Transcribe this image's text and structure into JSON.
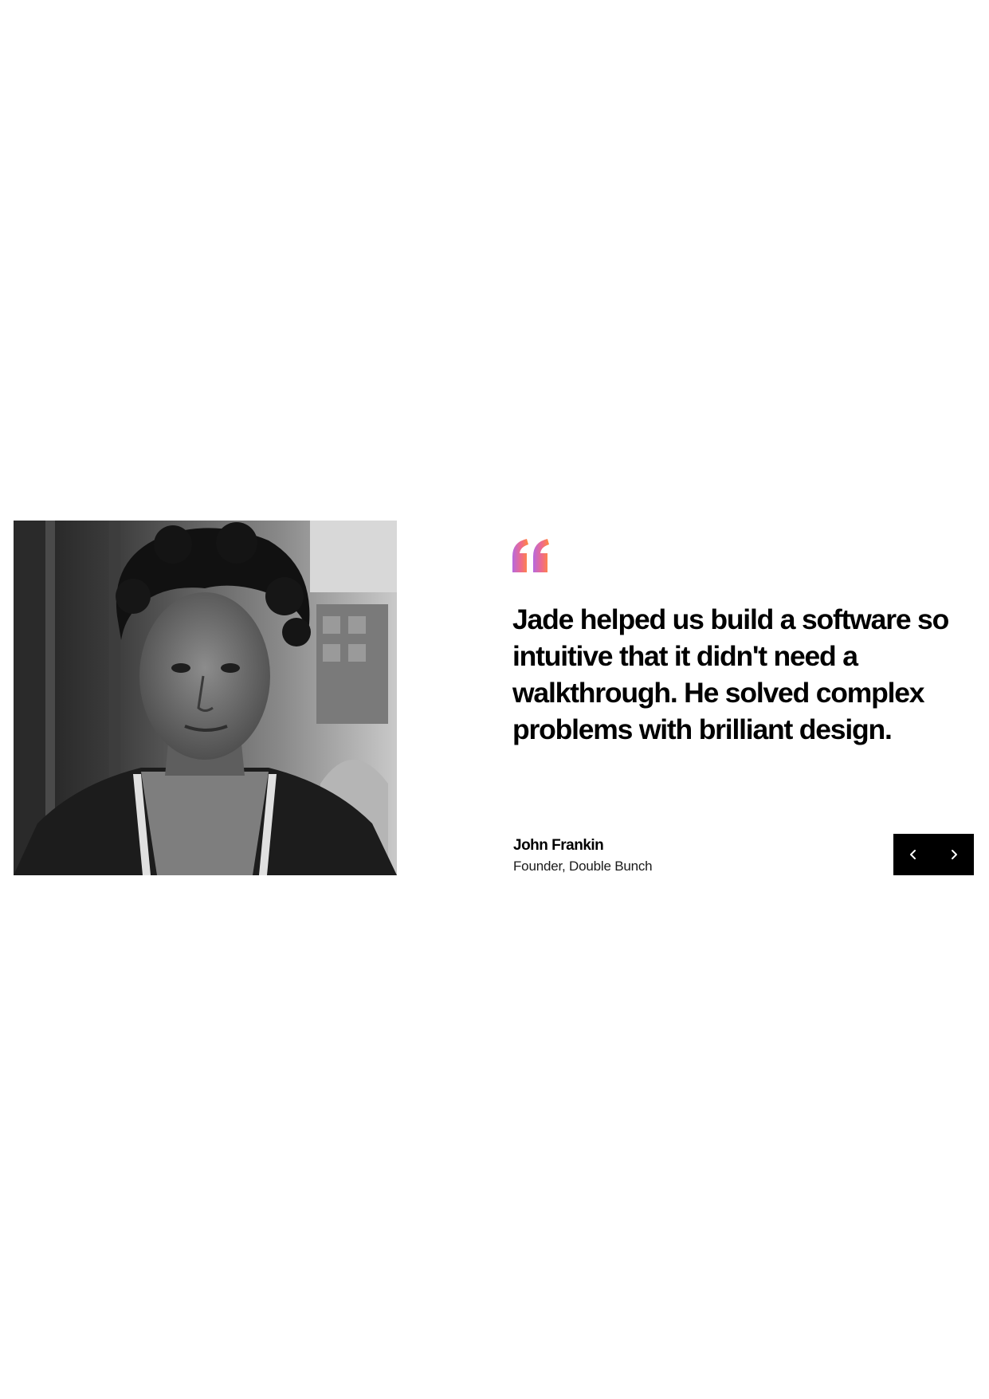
{
  "testimonial": {
    "quote": "Jade helped us build a software so intuitive that it didn't need a walkthrough. He solved complex problems with brilliant design.",
    "author_name": "John Frankin",
    "author_role": "Founder, Double Bunch",
    "photo_icon": "portrait-photo",
    "quote_icon": "quote-mark-icon",
    "quote_gradient": [
      "#b56ae0",
      "#f06a8a",
      "#ff8a3d"
    ]
  },
  "navigation": {
    "prev_icon": "chevron-left-icon",
    "next_icon": "chevron-right-icon",
    "background": "#000000",
    "icon_color": "#ffffff"
  }
}
